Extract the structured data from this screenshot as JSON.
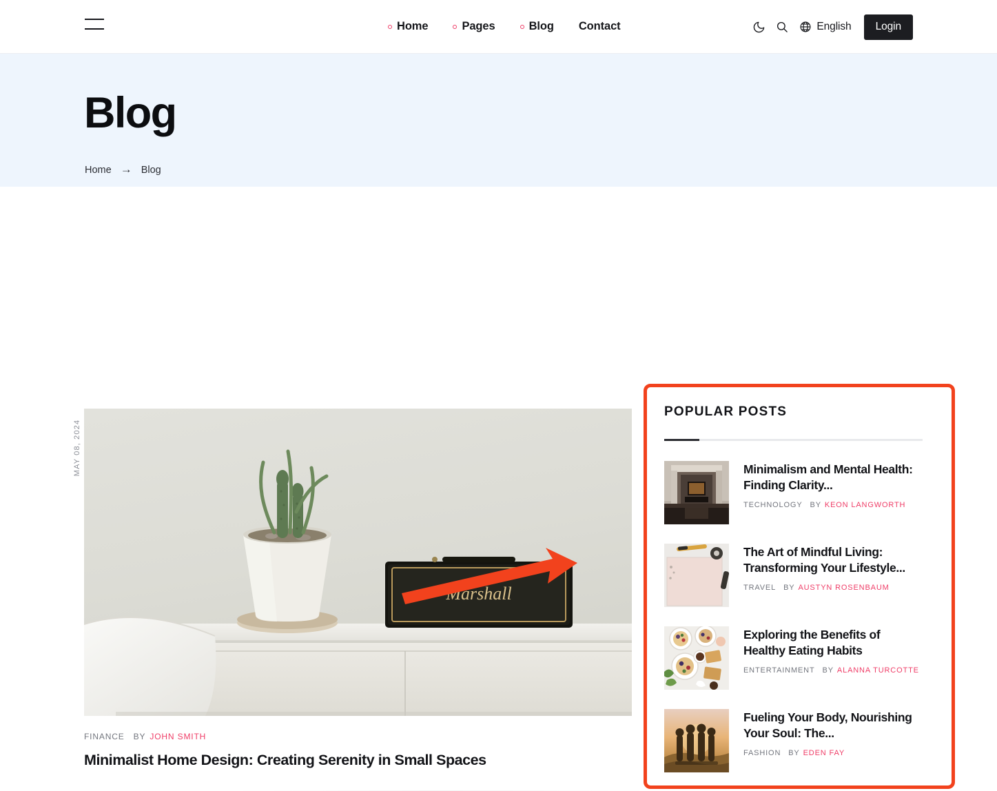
{
  "header": {
    "menu_icon": "hamburger-icon",
    "nav": [
      {
        "label": "Home",
        "has_dropdown": true
      },
      {
        "label": "Pages",
        "has_dropdown": true
      },
      {
        "label": "Blog",
        "has_dropdown": true
      },
      {
        "label": "Contact",
        "has_dropdown": false
      }
    ],
    "dark_mode_icon": "moon-icon",
    "search_icon": "search-icon",
    "language_icon": "globe-icon",
    "language": "English",
    "login_label": "Login"
  },
  "hero": {
    "title": "Blog",
    "breadcrumb": [
      {
        "label": "Home",
        "current": false
      },
      {
        "label": "Blog",
        "current": true
      }
    ],
    "breadcrumb_separator": "→",
    "background_color": "#EEF5FD"
  },
  "main_post": {
    "date": "MAY 08, 2024",
    "category": "FINANCE",
    "by_label": "BY",
    "author": "JOHN SMITH",
    "title": "Minimalist Home Design: Creating Serenity in Small Spaces",
    "image_alt": "minimalist-interior-cactus-and-speaker-on-white-sideboard"
  },
  "annotation": {
    "arrow_color": "#F2421D",
    "highlight_color": "#F2421D",
    "highlight_target": "popular-posts-widget"
  },
  "sidebar": {
    "widget_title": "POPULAR POSTS",
    "posts": [
      {
        "title": "Minimalism and Mental Health: Finding Clarity...",
        "category": "TECHNOLOGY",
        "by_label": "BY",
        "author": "KEON LANGWORTH",
        "thumb_alt": "museum-gallery-interior"
      },
      {
        "title": "The Art of Mindful Living: Transforming Your Lifestyle...",
        "category": "TRAVEL",
        "by_label": "BY",
        "author": "AUSTYN ROSENBAUM",
        "thumb_alt": "desk-with-paper-and-pencil"
      },
      {
        "title": "Exploring the Benefits of Healthy Eating Habits",
        "category": "ENTERTAINMENT",
        "by_label": "BY",
        "author": "ALANNA TURCOTTE",
        "thumb_alt": "healthy-food-bowls-flatlay"
      },
      {
        "title": "Fueling Your Body, Nourishing Your Soul: The...",
        "category": "FASHION",
        "by_label": "BY",
        "author": "EDEN FAY",
        "thumb_alt": "friends-at-sunset-on-hill"
      }
    ]
  },
  "colors": {
    "accent_pink": "#EF3D67",
    "annotation_red": "#F2421D",
    "hero_blue": "#EEF5FD",
    "text_dark": "#121317"
  }
}
